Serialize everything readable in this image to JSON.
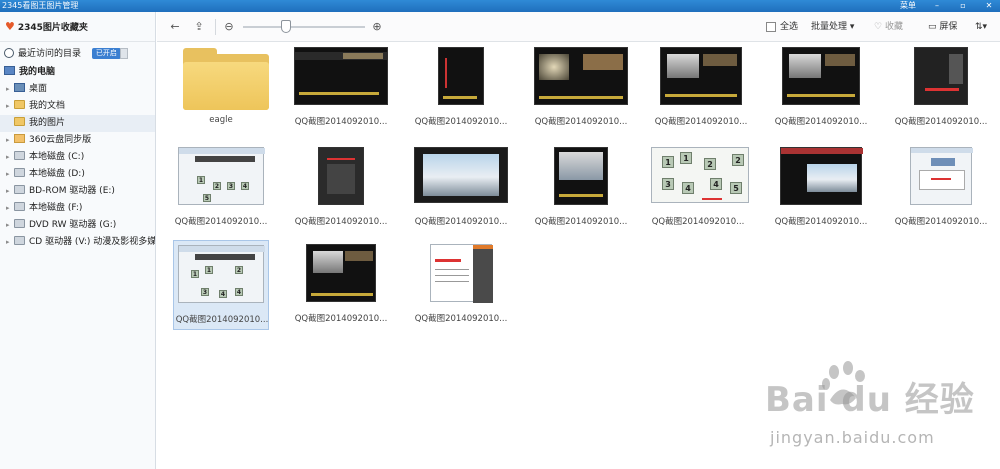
{
  "window": {
    "title": "2345看图王图片管理",
    "menu_label": "菜单"
  },
  "sidebar": {
    "header": "2345图片收藏夹",
    "recent": "最近访问的目录",
    "recent_toggle_on": "已开启",
    "computer": "我的电脑",
    "items": [
      {
        "label": "桌面"
      },
      {
        "label": "我的文档"
      },
      {
        "label": "我的图片"
      },
      {
        "label": "360云盘同步版"
      },
      {
        "label": "本地磁盘 (C:)"
      },
      {
        "label": "本地磁盘 (D:)"
      },
      {
        "label": "BD-ROM 驱动器 (E:)"
      },
      {
        "label": "本地磁盘 (F:)"
      },
      {
        "label": "DVD RW 驱动器 (G:)"
      },
      {
        "label": "CD 驱动器 (V:) 动漫及影视多媒体"
      }
    ]
  },
  "toolbar": {
    "select_all": "全选",
    "batch": "批量处理",
    "favorite": "收藏",
    "screen": "屏保",
    "zoom_level": 0.35
  },
  "files": [
    {
      "name": "eagle"
    },
    {
      "name": "QQ截图2014092010..."
    },
    {
      "name": "QQ截图2014092010..."
    },
    {
      "name": "QQ截图2014092010..."
    },
    {
      "name": "QQ截图2014092010..."
    },
    {
      "name": "QQ截图2014092010..."
    },
    {
      "name": "QQ截图2014092010..."
    },
    {
      "name": "QQ截图2014092010..."
    },
    {
      "name": "QQ截图2014092010..."
    },
    {
      "name": "QQ截图2014092010..."
    },
    {
      "name": "QQ截图2014092010..."
    },
    {
      "name": "QQ截图2014092010..."
    },
    {
      "name": "QQ截图2014092010..."
    },
    {
      "name": "QQ截图2014092010..."
    },
    {
      "name": "QQ截图2014092010..."
    },
    {
      "name": "QQ截图2014092010..."
    },
    {
      "name": "QQ截图2014092010..."
    }
  ],
  "watermark": {
    "logo": "Bai  du 经验",
    "url": "jingyan.baidu.com"
  },
  "colors": {
    "titlebar": "#1f6fbd",
    "accent": "#3b7fd1",
    "selection": "#dbe8f6"
  }
}
